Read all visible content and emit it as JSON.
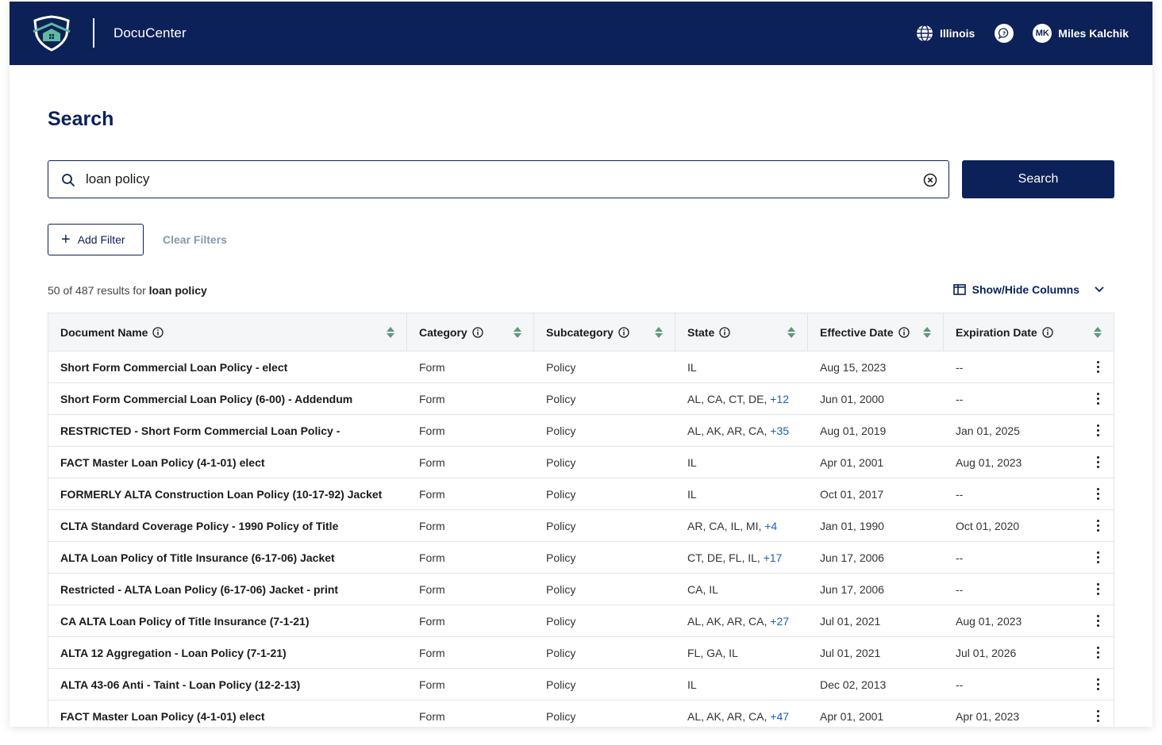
{
  "header": {
    "app_name": "DocuCenter",
    "region": "Illinois",
    "user_initials": "MK",
    "user_name": "Miles Kalchik"
  },
  "page": {
    "title": "Search"
  },
  "search": {
    "value": "loan policy",
    "button_label": "Search"
  },
  "filters": {
    "add_label": "Add Filter",
    "clear_label": "Clear Filters"
  },
  "results": {
    "shown": "50",
    "of_text": "of",
    "total": "487",
    "results_for_text": "results for",
    "query": "loan policy",
    "columns_toggle_label": "Show/Hide Columns"
  },
  "table": {
    "columns": [
      "Document Name",
      "Category",
      "Subcategory",
      "State",
      "Effective Date",
      "Expiration Date"
    ],
    "rows": [
      {
        "name": "Short Form Commercial Loan Policy - elect",
        "category": "Form",
        "subcategory": "Policy",
        "states": "IL",
        "more": "",
        "effective": "Aug 15, 2023",
        "expiration": "--"
      },
      {
        "name": "Short Form Commercial Loan Policy (6-00) - Addendum",
        "category": "Form",
        "subcategory": "Policy",
        "states": "AL, CA, CT, DE,",
        "more": "+12",
        "effective": "Jun 01, 2000",
        "expiration": "--"
      },
      {
        "name": "RESTRICTED - Short Form Commercial Loan Policy -",
        "category": "Form",
        "subcategory": "Policy",
        "states": "AL, AK, AR, CA,",
        "more": "+35",
        "effective": "Aug 01, 2019",
        "expiration": "Jan 01, 2025"
      },
      {
        "name": "FACT Master Loan Policy (4-1-01) elect",
        "category": "Form",
        "subcategory": "Policy",
        "states": "IL",
        "more": "",
        "effective": "Apr 01, 2001",
        "expiration": "Aug 01, 2023"
      },
      {
        "name": "FORMERLY ALTA Construction Loan Policy (10-17-92) Jacket",
        "category": "Form",
        "subcategory": "Policy",
        "states": "IL",
        "more": "",
        "effective": "Oct 01, 2017",
        "expiration": "--"
      },
      {
        "name": "CLTA Standard Coverage Policy - 1990 Policy of Title",
        "category": "Form",
        "subcategory": "Policy",
        "states": "AR, CA, IL, MI,",
        "more": "+4",
        "effective": "Jan 01, 1990",
        "expiration": "Oct 01, 2020"
      },
      {
        "name": "ALTA Loan Policy of Title Insurance (6-17-06) Jacket",
        "category": "Form",
        "subcategory": "Policy",
        "states": "CT, DE, FL, IL,",
        "more": "+17",
        "effective": "Jun 17, 2006",
        "expiration": "--"
      },
      {
        "name": "Restricted - ALTA Loan Policy (6-17-06) Jacket - print",
        "category": "Form",
        "subcategory": "Policy",
        "states": "CA, IL",
        "more": "",
        "effective": "Jun 17, 2006",
        "expiration": "--"
      },
      {
        "name": "CA ALTA Loan Policy of Title Insurance (7-1-21)",
        "category": "Form",
        "subcategory": "Policy",
        "states": "AL, AK, AR, CA,",
        "more": "+27",
        "effective": "Jul 01, 2021",
        "expiration": "Aug 01, 2023"
      },
      {
        "name": "ALTA 12 Aggregation - Loan Policy (7-1-21)",
        "category": "Form",
        "subcategory": "Policy",
        "states": "FL, GA, IL",
        "more": "",
        "effective": "Jul 01, 2021",
        "expiration": "Jul 01, 2026"
      },
      {
        "name": "ALTA 43-06 Anti - Taint - Loan Policy (12-2-13)",
        "category": "Form",
        "subcategory": "Policy",
        "states": "IL",
        "more": "",
        "effective": "Dec 02, 2013",
        "expiration": "--"
      },
      {
        "name": "FACT Master Loan Policy (4-1-01) elect",
        "category": "Form",
        "subcategory": "Policy",
        "states": "AL, AK, AR, CA,",
        "more": "+47",
        "effective": "Apr 01, 2001",
        "expiration": "Apr 01, 2023"
      }
    ]
  },
  "colors": {
    "navy": "#0c2157",
    "sort_arrow": "#5a9a7c",
    "link_blue": "#1b5fb5"
  },
  "icons": [
    "shield-house-logo-icon",
    "globe-icon",
    "chat-icon",
    "search-icon",
    "clear-circle-icon",
    "plus-icon",
    "columns-icon",
    "chevron-down-icon",
    "info-icon",
    "sort-icon",
    "kebab-icon"
  ]
}
